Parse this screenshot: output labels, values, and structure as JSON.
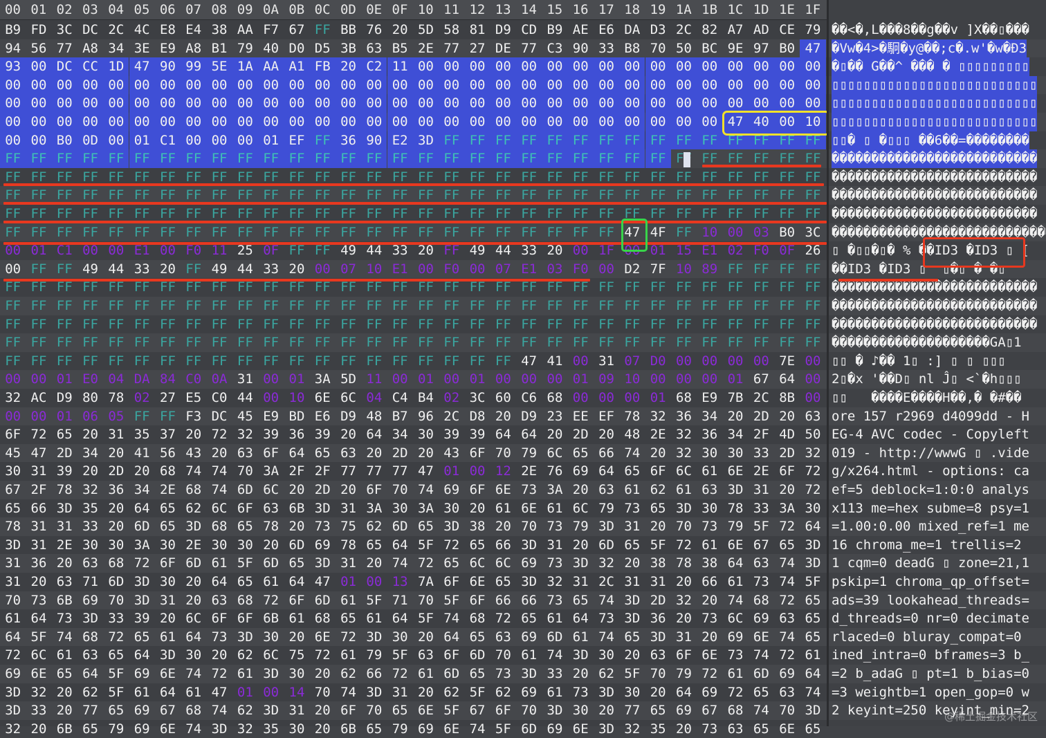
{
  "header": [
    "00",
    "01",
    "02",
    "03",
    "04",
    "05",
    "06",
    "07",
    "08",
    "09",
    "0A",
    "0B",
    "0C",
    "0D",
    "0E",
    "0F",
    "10",
    "11",
    "12",
    "13",
    "14",
    "15",
    "16",
    "17",
    "18",
    "19",
    "1A",
    "1B",
    "1C",
    "1D",
    "1E",
    "1F"
  ],
  "rows": [
    "B9 FD 3C DC 2C 4C E8 E4 38 AA F7 67 FF BB 76 20 5D 58 81 D9 CD B9 AE E6 DA D3 2C 82 A7 AD CE 79",
    "94 56 77 A8 34 3E E9 A8 B1 79 40 D0 D5 3B 63 B5 2E 77 27 DE 77 C3 90 33 B8 70 50 BC 9E 97 B0 47",
    "93 00 DC CC 1D 47 90 99 5E 1A AA A1 FB 20 C2 11 00 00 00 00 00 00 00 00 00 00 00 00 00 00 00 00",
    "00 00 00 00 00 00 00 00 00 00 00 00 00 00 00 00 00 00 00 00 00 00 00 00 00 00 00 00 00 00 00 00",
    "00 00 00 00 00 00 00 00 00 00 00 00 00 00 00 00 00 00 00 00 00 00 00 00 00 00 00 00 00 00 00 00",
    "00 00 00 00 00 00 00 00 00 00 00 00 00 00 00 00 00 00 00 00 00 00 00 00 00 00 00 00 47 40 00 10",
    "00 00 B0 0D 00 01 C1 00 00 00 01 EF FF 36 90 E2 3D FF FF FF FF FF FF FF FF FF FF FF FF FF FF FF",
    "FF FF FF FF FF FF FF FF FF FF FF FF FF FF FF FF FF FF FF FF FF FF FF FF FF FF FF FF FF FF FF FF",
    "FF FF FF FF FF FF FF FF FF FF FF FF FF FF FF FF FF FF FF FF FF FF FF FF FF FF FF FF FF FF FF FF",
    "FF FF FF FF FF FF FF FF FF FF FF FF FF FF FF FF FF FF FF FF FF FF FF FF FF FF FF FF FF FF FF FF",
    "FF FF FF FF FF FF FF FF FF FF FF FF FF FF FF FF FF FF FF FF FF FF FF FF FF FF FF FF FF FF FF FF",
    "FF FF FF FF FF FF FF FF FF FF FF FF FF FF FF FF FF FF FF FF FF FF FF FF 47 4F FF 10 00 03 B0 3C",
    "00 01 C1 00 00 E1 00 F0 11 25 0F FF FF 49 44 33 20 FF 49 44 33 20 00 1F 00 01 15 E1 02 F0 0F 26",
    "00 FF FF 49 44 33 20 FF 49 44 33 20 00 07 10 E1 00 F0 00 07 E1 03 F0 00 D2 7F 10 89 FF FF FF FF",
    "FF FF FF FF FF FF FF FF FF FF FF FF FF FF FF FF FF FF FF FF FF FF FF FF FF FF FF FF FF FF FF FF",
    "FF FF FF FF FF FF FF FF FF FF FF FF FF FF FF FF FF FF FF FF FF FF FF FF FF FF FF FF FF FF FF FF",
    "FF FF FF FF FF FF FF FF FF FF FF FF FF FF FF FF FF FF FF FF FF FF FF FF FF FF FF FF FF FF FF FF",
    "FF FF FF FF FF FF FF FF FF FF FF FF FF FF FF FF FF FF FF FF FF FF FF FF FF FF FF FF FF FF FF FF",
    "FF FF FF FF FF FF FF FF FF FF FF FF FF FF FF FF FF FF FF FF 47 41 00 31 07 D0 00 00 00 00 7E 00",
    "00 00 01 E0 04 DA 84 C0 0A 31 00 01 3A 5D 11 00 01 00 01 00 00 00 01 09 10 00 00 00 01 67 64 00",
    "32 AC D9 80 78 02 27 E5 C0 44 00 10 6E 6C 04 C4 B4 02 3C 60 C6 68 00 00 00 01 68 E9 7B 2C 8B 00",
    "00 00 01 06 05 FF FF F3 DC 45 E9 BD E6 D9 48 B7 96 2C D8 20 D9 23 EE EF 78 32 36 34 20 2D 20 63",
    "6F 72 65 20 31 35 37 20 72 32 39 36 39 20 64 34 30 39 39 64 64 20 2D 20 48 2E 32 36 34 2F 4D 50",
    "45 47 2D 34 20 41 56 43 20 63 6F 64 65 63 20 2D 20 43 6F 70 79 6C 65 66 74 20 32 30 30 33 2D 32",
    "30 31 39 20 2D 20 68 74 74 70 3A 2F 2F 77 77 77 47 01 00 12 2E 76 69 64 65 6F 6C 61 6E 2E 6F 72",
    "67 2F 78 32 36 34 2E 68 74 6D 6C 20 2D 20 6F 70 74 69 6F 6E 73 3A 20 63 61 62 61 63 3D 31 20 72",
    "65 66 3D 35 20 64 65 62 6C 6F 63 6B 3D 31 3A 30 3A 30 20 61 6E 61 6C 79 73 65 3D 30 78 33 3A 30",
    "78 31 31 33 20 6D 65 3D 68 65 78 20 73 75 62 6D 65 3D 38 20 70 73 79 3D 31 20 70 73 79 5F 72 64",
    "3D 31 2E 30 30 3A 30 2E 30 30 20 6D 69 78 65 64 5F 72 65 66 3D 31 20 6D 65 5F 72 61 6E 67 65 3D",
    "31 36 20 63 68 72 6F 6D 61 5F 6D 65 3D 31 20 74 72 65 6C 6C 69 73 3D 32 20 38 78 38 64 63 74 3D",
    "31 20 63 71 6D 3D 30 20 64 65 61 64 47 01 00 13 7A 6F 6E 65 3D 32 31 2C 31 31 20 66 61 73 74 5F",
    "70 73 6B 69 70 3D 31 20 63 68 72 6F 6D 61 5F 71 70 5F 6F 66 66 73 65 74 3D 2D 32 20 74 68 72 65",
    "61 64 73 3D 33 39 20 6C 6F 6F 6B 61 68 65 61 64 5F 74 68 72 65 61 64 73 3D 36 20 73 6C 69 63 65",
    "64 5F 74 68 72 65 61 64 73 3D 30 20 6E 72 3D 30 20 64 65 63 69 6D 61 74 65 3D 31 20 69 6E 74 65",
    "72 6C 61 63 65 64 3D 30 20 62 6C 75 72 61 79 5F 63 6F 6D 70 61 74 3D 30 20 63 6F 6E 73 74 72 61",
    "69 6E 65 64 5F 69 6E 74 72 61 3D 30 20 62 66 72 61 6D 65 73 3D 33 20 62 5F 70 79 72 61 6D 69 64",
    "3D 32 20 62 5F 61 64 61 47 01 00 14 70 74 3D 31 20 62 5F 62 69 61 73 3D 30 20 64 69 72 65 63 74",
    "3D 33 20 77 65 69 67 68 74 62 3D 31 20 6F 70 65 6E 5F 67 6F 70 3D 30 20 77 65 69 67 68 74 70 3D",
    "32 20 6B 65 79 69 6E 74 3D 32 35 30 20 6B 65 79 69 6E 74 5F 6D 69 6E 3D 32 35 20 73 63 65 6E 65"
  ],
  "ascii": [
    "��<�,L���8��g��v ]X��▯���",
    "�Vw�4>�駉�y@��;c�.w'�w�Ð3",
    "�▯�� G��^ ��� � ▯▯▯▯▯▯▯▯▯",
    "▯▯▯▯▯▯▯▯▯▯▯▯▯▯▯▯▯▯▯▯▯▯▯▯▯▯",
    "▯▯▯▯▯▯▯▯▯▯▯▯▯▯▯▯▯▯▯▯▯▯▯▯▯▯",
    "▯▯▯▯▯▯▯▯▯▯▯▯▯▯▯▯▯▯▯▯▯▯▯▯▯▯",
    "▯▯� ▯ �▯▯▯ ��6��=��������",
    "��������������������������",
    "��������������������������",
    "��������������������������",
    "��������������������������",
    "����������������������������",
    "▯ �▯▯�▯� % ��ID3 �ID3 ▯ [",
    "��ID3 �ID3 ▯  ▯�▯ � �▯",
    "��������������������������",
    "��������������������������",
    "��������������������������",
    "��������������������GA▯1",
    "▯▯ � ♪�� 1▯ :] ▯ ▯ ▯▯▯",
    "2▯�x '��D▯ nl Ĵ▯ <`�h▯▯▯",
    "▯▯   ����E����H��,� �#��",
    "ore 157 r2969 d4099dd - H",
    "EG-4 AVC codec - Copyleft",
    "019 - http://wwwG ▯ .vide",
    "g/x264.html - options: ca",
    "ef=5 deblock=1:0:0 analys",
    "x113 me=hex subme=8 psy=1",
    "=1.00:0.00 mixed_ref=1 me",
    "16 chroma_me=1 trellis=2",
    "1 cqm=0 deadG ▯ zone=21,1",
    "pskip=1 chroma_qp_offset=",
    "ads=39 lookahead_threads=",
    "d_threads=0 nr=0 decimate",
    "rlaced=0 bluray_compat=0",
    "ined_intra=0 bframes=3 b_",
    "=2 b_adaG ▯ pt=1 b_bias=0",
    "=3 weightb=1 open_gop=0 w",
    "2 keyint=250 keyint_min=2"
  ],
  "watermark": "@稀土掘金技术社区",
  "colors": {
    "selection": "#3f4fd6",
    "ff_byte": "#3aa6a0",
    "zero_in_ts": "#8a2bd6",
    "annotation_red": "#e8381f",
    "annotation_yellow": "#f1e12a",
    "annotation_green": "#38d44a"
  }
}
